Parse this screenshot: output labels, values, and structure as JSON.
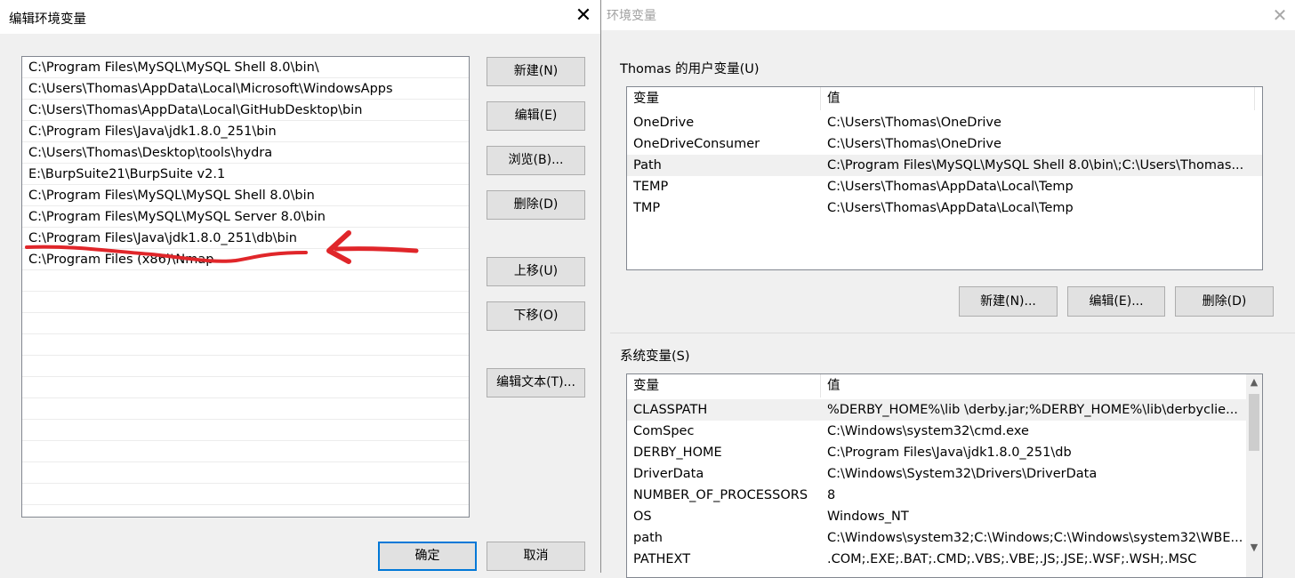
{
  "dialog": {
    "title": "编辑环境变量",
    "paths": [
      "C:\\Program Files\\MySQL\\MySQL Shell 8.0\\bin\\",
      "C:\\Users\\Thomas\\AppData\\Local\\Microsoft\\WindowsApps",
      "C:\\Users\\Thomas\\AppData\\Local\\GitHubDesktop\\bin",
      "C:\\Program Files\\Java\\jdk1.8.0_251\\bin",
      "C:\\Users\\Thomas\\Desktop\\tools\\hydra",
      "E:\\BurpSuite21\\BurpSuite v2.1",
      "C:\\Program Files\\MySQL\\MySQL Shell 8.0\\bin",
      "C:\\Program Files\\MySQL\\MySQL Server 8.0\\bin",
      "C:\\Program Files\\Java\\jdk1.8.0_251\\db\\bin",
      "C:\\Program Files (x86)\\Nmap"
    ],
    "buttons": {
      "new": "新建(N)",
      "edit": "编辑(E)",
      "browse": "浏览(B)...",
      "delete": "删除(D)",
      "move_up": "上移(U)",
      "move_down": "下移(O)",
      "edit_text": "编辑文本(T)...",
      "ok": "确定",
      "cancel": "取消"
    },
    "annotation_color": "#e0262a"
  },
  "env_window": {
    "title": "环境变量",
    "user_group_label": "Thomas 的用户变量(U)",
    "system_group_label": "系统变量(S)",
    "col_variable": "变量",
    "col_value": "值",
    "user_vars": [
      {
        "name": "OneDrive",
        "value": "C:\\Users\\Thomas\\OneDrive"
      },
      {
        "name": "OneDriveConsumer",
        "value": "C:\\Users\\Thomas\\OneDrive"
      },
      {
        "name": "Path",
        "value": "C:\\Program Files\\MySQL\\MySQL Shell 8.0\\bin\\;C:\\Users\\Thomas..."
      },
      {
        "name": "TEMP",
        "value": "C:\\Users\\Thomas\\AppData\\Local\\Temp"
      },
      {
        "name": "TMP",
        "value": "C:\\Users\\Thomas\\AppData\\Local\\Temp"
      }
    ],
    "user_buttons": {
      "new": "新建(N)...",
      "edit": "编辑(E)...",
      "delete": "删除(D)"
    },
    "system_vars": [
      {
        "name": "CLASSPATH",
        "value": "%DERBY_HOME%\\lib \\derby.jar;%DERBY_HOME%\\lib\\derbyclie..."
      },
      {
        "name": "ComSpec",
        "value": "C:\\Windows\\system32\\cmd.exe"
      },
      {
        "name": "DERBY_HOME",
        "value": "C:\\Program Files\\Java\\jdk1.8.0_251\\db"
      },
      {
        "name": "DriverData",
        "value": "C:\\Windows\\System32\\Drivers\\DriverData"
      },
      {
        "name": "NUMBER_OF_PROCESSORS",
        "value": "8"
      },
      {
        "name": "OS",
        "value": "Windows_NT"
      },
      {
        "name": "path",
        "value": "C:\\Windows\\system32;C:\\Windows;C:\\Windows\\system32\\WBE..."
      },
      {
        "name": "PATHEXT",
        "value": ".COM;.EXE;.BAT;.CMD;.VBS;.VBE;.JS;.JSE;.WSF;.WSH;.MSC"
      }
    ]
  }
}
